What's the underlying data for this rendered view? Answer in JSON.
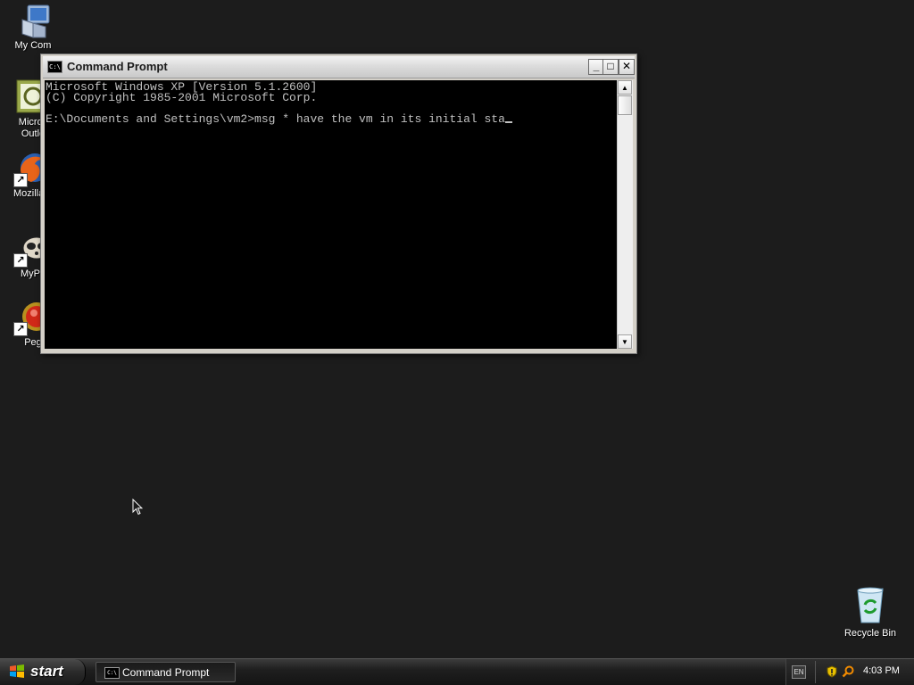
{
  "desktop_icons": [
    {
      "label": "My Computer",
      "display": "My Com",
      "icon": "my-computer-icon"
    },
    {
      "label": "Microsoft Outlook",
      "display_lines": [
        "Micros",
        "Outlo"
      ],
      "icon": "outlook-icon"
    },
    {
      "label": "Mozilla Firefox",
      "display": "Mozilla F",
      "icon": "firefox-icon"
    },
    {
      "label": "MyPal",
      "display": "MyPa",
      "icon": "mypal-icon"
    },
    {
      "label": "Pegasus",
      "display": "Peg",
      "icon": "pegasus-icon"
    }
  ],
  "recycle_bin": {
    "label": "Recycle Bin",
    "icon": "recycle-bin-icon"
  },
  "cmd_window": {
    "title": "Command Prompt",
    "title_icon": "C:\\",
    "buttons": {
      "minimize": "_",
      "maximize": "□",
      "close": "✕"
    },
    "lines": [
      "Microsoft Windows XP [Version 5.1.2600]",
      "(C) Copyright 1985-2001 Microsoft Corp.",
      "",
      "E:\\Documents and Settings\\vm2>msg * have the vm in its initial sta"
    ],
    "scrollbar": {
      "up": "▲",
      "down": "▼"
    }
  },
  "taskbar": {
    "start_label": "start",
    "task_items": [
      {
        "label": "Command Prompt",
        "icon": "C:\\"
      }
    ],
    "tray": {
      "language": "EN",
      "clock": "4:03 PM",
      "colors": {
        "shield": "#e8c000",
        "search": "#f08a00"
      }
    }
  },
  "colors": {
    "desktop_bg": "#1c1c1c",
    "console_bg": "#000000",
    "console_fg": "#c0c0c0"
  }
}
